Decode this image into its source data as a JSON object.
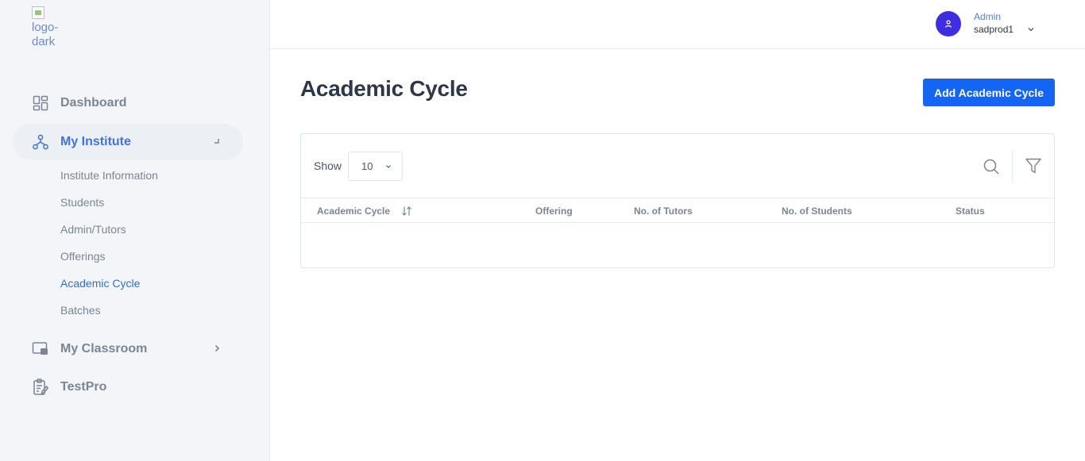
{
  "sidebar": {
    "logo_alt": "logo-dark",
    "nav": [
      {
        "label": "Dashboard",
        "icon": "dashboard-icon"
      },
      {
        "label": "My Institute",
        "icon": "hierarchy-icon",
        "active": true
      },
      {
        "label": "My Classroom",
        "icon": "classroom-icon"
      },
      {
        "label": "TestPro",
        "icon": "clipboard-edit-icon"
      }
    ],
    "institute_sub": [
      "Institute Information",
      "Students",
      "Admin/Tutors",
      "Offerings",
      "Academic Cycle",
      "Batches"
    ],
    "current_sub": "Academic Cycle"
  },
  "header": {
    "user_role": "Admin",
    "user_name": "sadprod1"
  },
  "main": {
    "title": "Academic Cycle",
    "add_button": "Add Academic Cycle",
    "show_label": "Show",
    "page_size": "10",
    "columns": [
      "Academic Cycle",
      "Offering",
      "No. of Tutors",
      "No. of Students",
      "Status"
    ],
    "rows": []
  },
  "colors": {
    "primary": "#1565f5",
    "active_nav": "#3f74e0",
    "avatar": "#3f2ee0",
    "sidebar_bg": "#f3f5f9"
  }
}
